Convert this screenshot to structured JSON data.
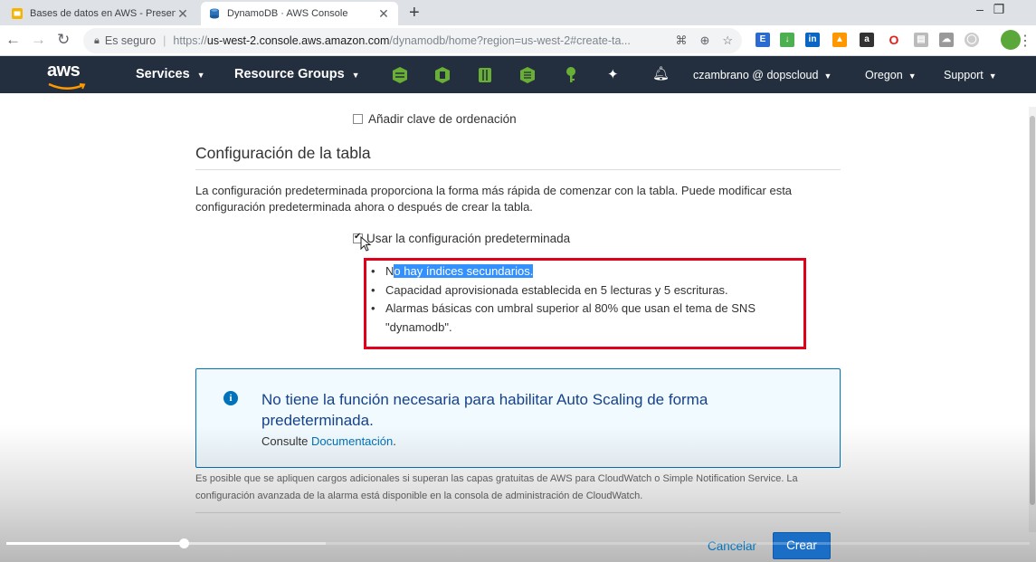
{
  "browser": {
    "tabs": [
      {
        "title": "Bases de datos en AWS - Present",
        "active": false
      },
      {
        "title": "DynamoDB · AWS Console",
        "active": true
      }
    ],
    "address": {
      "security_label": "Es seguro",
      "url_scheme": "https://",
      "url_host": "us-west-2.console.aws.amazon.com",
      "url_path": "/dynamodb/home?region=us-west-2#create-ta..."
    }
  },
  "aws_nav": {
    "logo_text": "aws",
    "services_label": "Services",
    "resource_groups_label": "Resource Groups",
    "account_label": "czambrano @ dopscloud",
    "region_label": "Oregon",
    "support_label": "Support"
  },
  "form": {
    "sort_key_label": "Añadir clave de ordenación",
    "sort_key_checked": false,
    "section_title": "Configuración de la tabla",
    "description": "La configuración predeterminada proporciona la forma más rápida de comenzar con la tabla. Puede modificar esta configuración predeterminada ahora o después de crear la tabla.",
    "use_default_label": "Usar la configuración predeterminada",
    "use_default_checked": true,
    "defaults": {
      "bullet1_first": "N",
      "bullet1_highlight": "o hay índices secundarios.",
      "bullet2": "Capacidad aprovisionada establecida en 5 lecturas y 5 escrituras.",
      "bullet3": "Alarmas básicas con umbral superior al 80% que usan el tema de SNS \"dynamodb\"."
    },
    "info": {
      "title": "No tiene la función necesaria para habilitar Auto Scaling de forma predeterminada.",
      "consult_label": "Consulte",
      "doc_link": "Documentación",
      "period": "."
    },
    "footnote": "Es posible que se apliquen cargos adicionales si superan las capas gratuitas de AWS para CloudWatch o Simple Notification Service. La configuración avanzada de la alarma está disponible en la consola de administración de CloudWatch.",
    "cancel_label": "Cancelar",
    "create_label": "Crear"
  },
  "video": {
    "played_fraction": 0.173,
    "buffered_fraction": 0.312
  },
  "colors": {
    "aws_nav_bg": "#232f3e",
    "aws_orange": "#ff9900",
    "service_icon_green": "#6aaf35",
    "highlight_box": "#e0001b",
    "info_blue": "#0073bb"
  }
}
